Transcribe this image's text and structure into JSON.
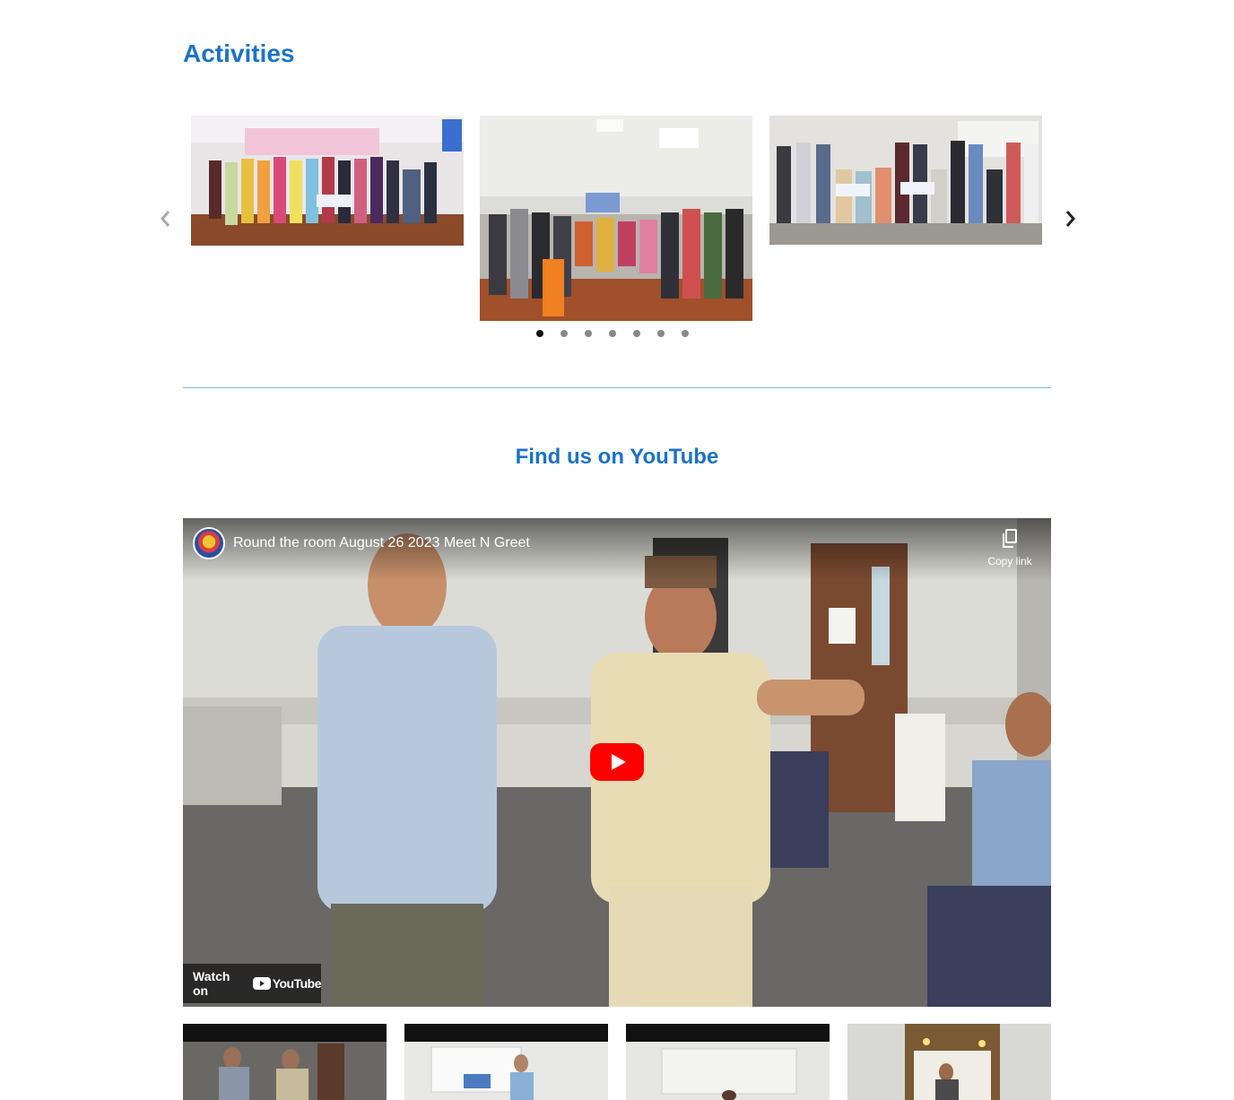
{
  "activities": {
    "title": "Activities",
    "carousel": {
      "prev_icon": "chevron-left-icon",
      "next_icon": "chevron-right-icon",
      "dot_count": 7,
      "active_dot": 1
    }
  },
  "youtube": {
    "title": "Find us on YouTube",
    "video": {
      "title": "Round the room August 26 2023 Meet N Greet",
      "copy_link_label": "Copy link",
      "watch_on_label": "Watch on",
      "logo_text": "YouTube"
    }
  },
  "colors": {
    "heading": "#1a73c8",
    "divider": "#7fb6d6",
    "youtube_red": "#ff0000"
  }
}
